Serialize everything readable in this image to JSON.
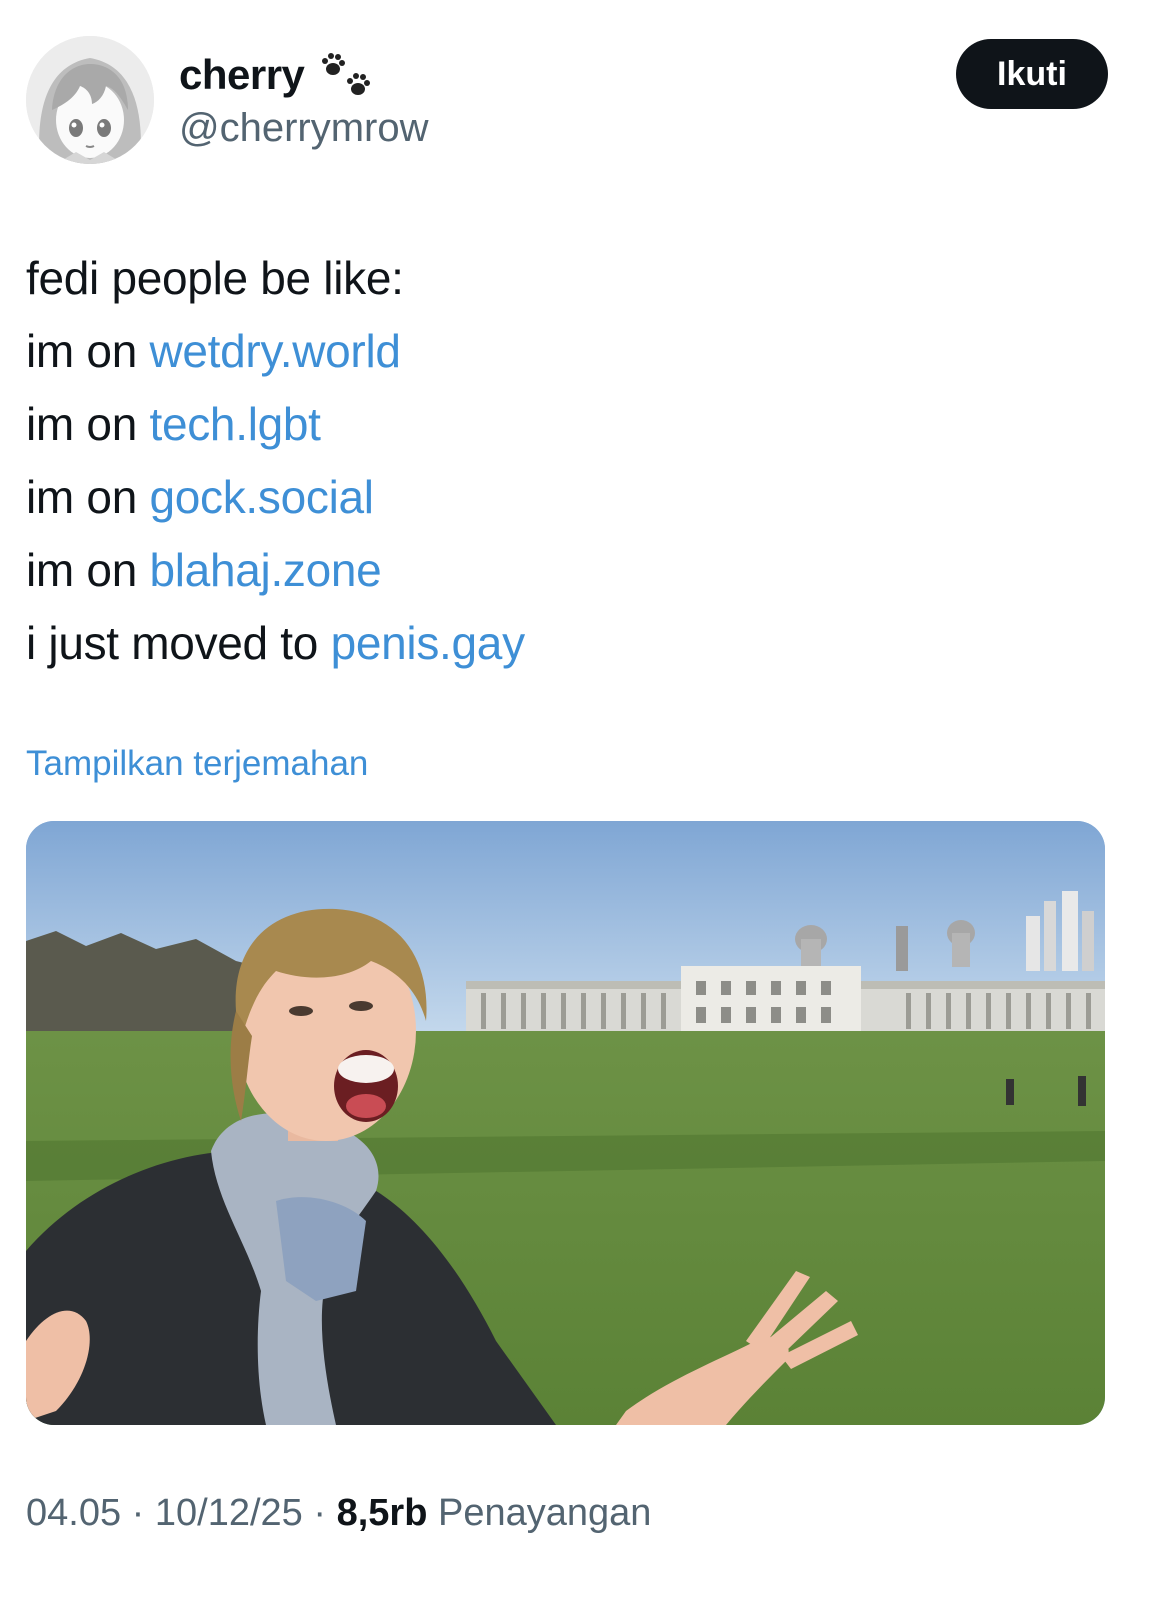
{
  "author": {
    "display_name": "cherry",
    "handle": "@cherrymrow",
    "name_emoji_icon": "paw-prints-icon",
    "avatar_icon": "anime-avatar"
  },
  "follow_button": {
    "label": "Ikuti"
  },
  "tweet": {
    "lines": [
      {
        "text": "fedi people be like:",
        "link": ""
      },
      {
        "text": "im on ",
        "link": "wetdry.world"
      },
      {
        "text": "im on ",
        "link": "tech.lgbt"
      },
      {
        "text": "im on ",
        "link": "gock.social"
      },
      {
        "text": "im on ",
        "link": "blahaj.zone"
      },
      {
        "text": "i just moved to ",
        "link": "penis.gay"
      }
    ],
    "link_color": "#3e8fd6"
  },
  "translate": {
    "label": "Tampilkan terjemahan"
  },
  "meta": {
    "time": "04.05",
    "separator": " · ",
    "date": "10/12/25",
    "views_count": "8,5rb",
    "views_label": "Penayangan"
  }
}
